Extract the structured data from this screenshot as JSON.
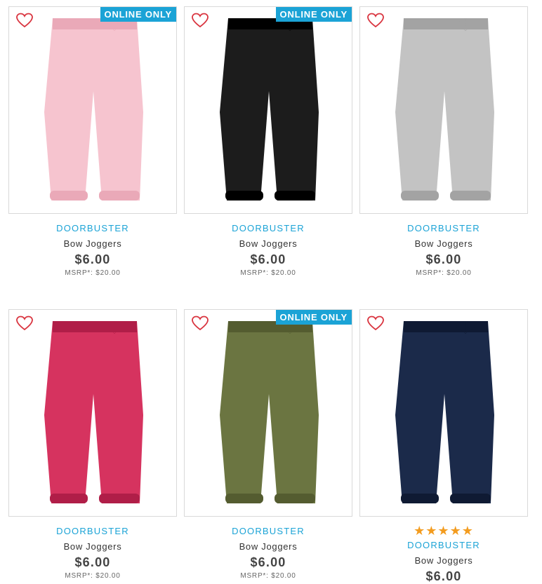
{
  "products": [
    {
      "label": "DOORBUSTER",
      "name": "Bow Joggers",
      "price": "$6.00",
      "msrp": "MSRP*: $20.00",
      "badge": "ONLINE ONLY",
      "color": "#f6c4cf",
      "shade": "#eaa9b8"
    },
    {
      "label": "DOORBUSTER",
      "name": "Bow Joggers",
      "price": "$6.00",
      "msrp": "MSRP*: $20.00",
      "badge": "ONLINE ONLY",
      "color": "#1c1c1c",
      "shade": "#000000"
    },
    {
      "label": "DOORBUSTER",
      "name": "Bow Joggers",
      "price": "$6.00",
      "msrp": "MSRP*: $20.00",
      "badge": "",
      "color": "#c3c3c3",
      "shade": "#a3a3a3"
    },
    {
      "label": "DOORBUSTER",
      "name": "Bow Joggers",
      "price": "$6.00",
      "msrp": "MSRP*: $20.00",
      "badge": "",
      "color": "#d6335f",
      "shade": "#b01e48"
    },
    {
      "label": "DOORBUSTER",
      "name": "Bow Joggers",
      "price": "$6.00",
      "msrp": "MSRP*: $20.00",
      "badge": "ONLINE ONLY",
      "color": "#6b7541",
      "shade": "#545c30"
    },
    {
      "label": "DOORBUSTER",
      "name": "Bow Joggers",
      "price": "$6.00",
      "msrp": "",
      "badge": "",
      "color": "#1b2a4a",
      "shade": "#0f1a33",
      "rating": "★★★★★"
    }
  ]
}
